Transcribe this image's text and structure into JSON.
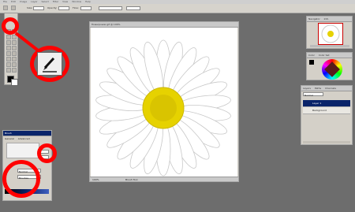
{
  "menu": [
    "File",
    "Edit",
    "Image",
    "Layer",
    "Select",
    "Filter",
    "View",
    "Window",
    "Help"
  ],
  "options": {
    "size_label": "Size:",
    "size_value": "",
    "opacity_label": "Opacity:",
    "opacity_value": "",
    "flow_label": "Flow:",
    "flow_value": ""
  },
  "document": {
    "title": "flowerpower.gif @ 100%",
    "zoom": "100%",
    "status": "Brush Tool"
  },
  "navigator": {
    "title": "Navigator",
    "tab2": "Info"
  },
  "color": {
    "title": "Color",
    "tab2": "Color Set"
  },
  "layers": {
    "tab1": "Layers",
    "tab2": "Paths",
    "tab3": "Channels",
    "blend": "Normal",
    "rows": [
      {
        "name": "Layer 1"
      },
      {
        "name": "Background"
      }
    ]
  },
  "brush": {
    "title": "Brush",
    "tab1": "General",
    "tab2": "Advanced",
    "fields": [
      "Normal",
      "Brushes"
    ]
  },
  "colors": {
    "accent_red": "#ff0000",
    "selection": "#0a246a",
    "flower_center": "#e6d200"
  }
}
